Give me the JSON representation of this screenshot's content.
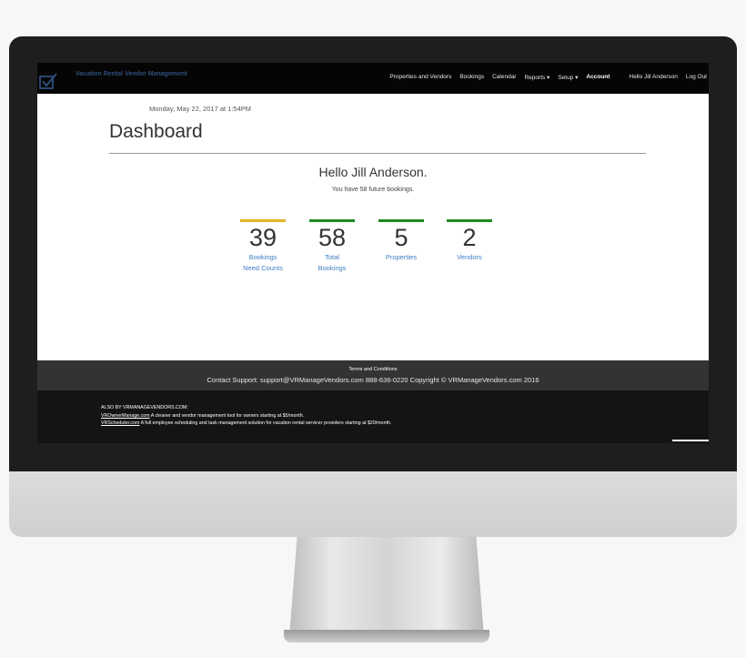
{
  "app": {
    "brand_title": "Vacation Rental Vendor Management",
    "brand_icon": "checkmark-logo-icon"
  },
  "nav": {
    "items": [
      {
        "label": "Properties and Vendors"
      },
      {
        "label": "Bookings"
      },
      {
        "label": "Calendar"
      },
      {
        "label": "Reports ▾"
      },
      {
        "label": "Setup ▾"
      },
      {
        "label": "Account"
      }
    ],
    "greeting": "Hello Jill Anderson",
    "logout": "Log Out"
  },
  "dashboard": {
    "date_line": "Monday, May 22, 2017 at 1:54PM",
    "title": "Dashboard",
    "hello": "Hello Jill Anderson.",
    "summary": "You have 58 future bookings.",
    "stats": [
      {
        "value": "39",
        "label": "Bookings Need Counts",
        "color": "#e8b32a"
      },
      {
        "value": "58",
        "label": "Total Bookings",
        "color": "#1e8a1e"
      },
      {
        "value": "5",
        "label": "Properties",
        "color": "#1e8a1e"
      },
      {
        "value": "2",
        "label": "Vendors",
        "color": "#1e8a1e"
      }
    ]
  },
  "footer": {
    "terms": "Terms and Conditions",
    "support": "Contact Support: support@VRManageVendors.com 888-636-0220 Copyright © VRManageVendors.com 2016",
    "also_heading": "ALSO BY VRMANAGEVENDORS.COM:",
    "products": [
      {
        "link": "VROwnerManage.com",
        "desc": " A cleaner and vendor management tool for owners starting at $5/month."
      },
      {
        "link": "VRScheduler.com",
        "desc": " A full employee scheduling and task management solution for vacation rental servicer providers starting at $20/month."
      }
    ]
  },
  "colors": {
    "navbar": "#050505",
    "link": "#3f7ec2",
    "footer_top": "#333333",
    "footer_bottom": "#141414"
  }
}
